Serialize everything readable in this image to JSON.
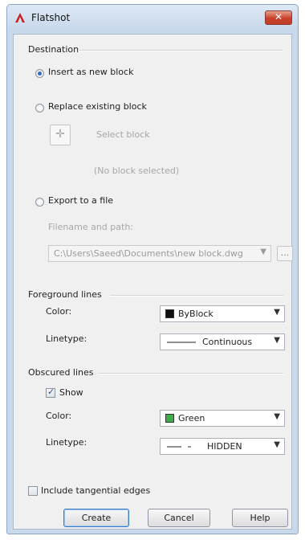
{
  "window": {
    "title": "Flatshot",
    "close_glyph": "✕"
  },
  "destination": {
    "label": "Destination",
    "insert_new_block": "Insert as new block",
    "replace_existing": "Replace existing block",
    "select_block": "Select block",
    "no_block_selected": "(No block selected)",
    "export_to_file": "Export to a file",
    "filename_label": "Filename and path:",
    "filename_value": "C:\\Users\\Saeed\\Documents\\new block.dwg",
    "browse_label": "...",
    "selected_option": "insert"
  },
  "foreground": {
    "label": "Foreground lines",
    "color_label": "Color:",
    "color_value": "ByBlock",
    "color_swatch": "#111111",
    "linetype_label": "Linetype:",
    "linetype_value": "Continuous"
  },
  "obscured": {
    "label": "Obscured lines",
    "show_label": "Show",
    "show_checked": true,
    "color_label": "Color:",
    "color_value": "Green",
    "color_swatch": "#3fae49",
    "linetype_label": "Linetype:",
    "linetype_value": "HIDDEN"
  },
  "options": {
    "tangential_edges": "Include tangential edges",
    "tangential_checked": false
  },
  "buttons": {
    "create": "Create",
    "cancel": "Cancel",
    "help": "Help"
  },
  "icons": {
    "app": "autocad-logo-icon",
    "pick": "pick-point-icon",
    "check": "✓"
  }
}
